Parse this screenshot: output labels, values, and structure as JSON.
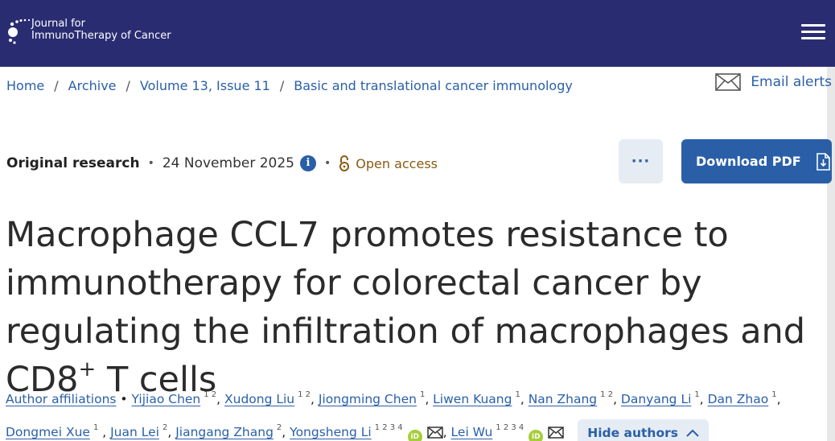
{
  "header": {
    "logo_line1": "Journal for",
    "logo_line2": "ImmunoTherapy of Cancer",
    "menu_icon": "hamburger-icon"
  },
  "breadcrumb": [
    {
      "label": "Home"
    },
    {
      "label": "Archive"
    },
    {
      "label": "Volume 13, Issue 11"
    },
    {
      "label": "Basic and translational cancer immunology"
    }
  ],
  "email_alerts": {
    "label": "Email alerts",
    "icon": "envelope-icon"
  },
  "meta": {
    "article_type": "Original research",
    "date": "24 November 2025",
    "info_icon": "i",
    "access": "Open access"
  },
  "actions": {
    "more_label": "···",
    "download_label": "Download PDF"
  },
  "article": {
    "title_before_sup": "Macrophage CCL7 promotes resistance to immunotherapy for colorectal cancer by regulating the infiltration of macrophages and CD8",
    "title_sup": "+",
    "title_after_sup": " T cells"
  },
  "authors": {
    "affiliations_label": "Author affiliations",
    "list": [
      {
        "name": "Yijiao Chen",
        "aff": "1 2"
      },
      {
        "name": "Xudong Liu",
        "aff": "1 2"
      },
      {
        "name": "Jiongming Chen",
        "aff": "1"
      },
      {
        "name": "Liwen Kuang",
        "aff": "1"
      },
      {
        "name": "Nan Zhang",
        "aff": "1 2"
      },
      {
        "name": "Danyang Li",
        "aff": "1"
      },
      {
        "name": "Dan Zhao",
        "aff": "1"
      },
      {
        "name": "Dongmei Xue",
        "aff": "1"
      },
      {
        "name": "Juan Lei",
        "aff": "2"
      },
      {
        "name": "Jiangang Zhang",
        "aff": "2"
      },
      {
        "name": "Yongsheng Li",
        "aff": "1 2 3 4"
      },
      {
        "name": "Lei Wu",
        "aff": "1 2 3 4"
      }
    ],
    "orcid_label": "iD",
    "hide_label": "Hide authors"
  },
  "colors": {
    "header_bg": "#2a2c72",
    "link": "#2a5fa8",
    "open_access": "#8a5a12",
    "orcid": "#a6ce39"
  }
}
